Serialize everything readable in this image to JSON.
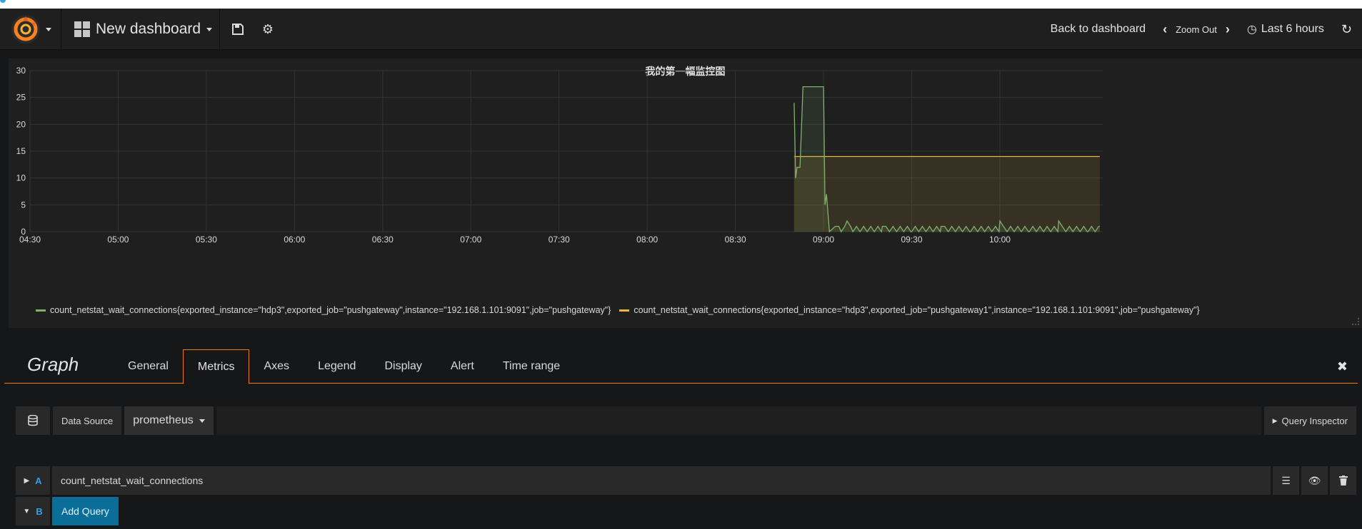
{
  "navbar": {
    "dashboard_title": "New dashboard",
    "back_label": "Back to dashboard",
    "zoom_out_label": "Zoom Out",
    "time_range_label": "Last 6 hours"
  },
  "panel": {
    "title": "我的第一幅监控图",
    "legend": [
      {
        "label": "count_netstat_wait_connections{exported_instance=\"hdp3\",exported_job=\"pushgateway\",instance=\"192.168.1.101:9091\",job=\"pushgateway\"}",
        "color": "#7eb26d"
      },
      {
        "label": "count_netstat_wait_connections{exported_instance=\"hdp3\",exported_job=\"pushgateway1\",instance=\"192.168.1.101:9091\",job=\"pushgateway\"}",
        "color": "#eab839"
      }
    ]
  },
  "chart_data": {
    "type": "area",
    "title": "我的第一幅监控图",
    "x_ticks": [
      "04:30",
      "05:00",
      "05:30",
      "06:00",
      "06:30",
      "07:00",
      "07:30",
      "08:00",
      "08:30",
      "09:00",
      "09:30",
      "10:00"
    ],
    "y_ticks": [
      "0",
      "5",
      "10",
      "15",
      "20",
      "25",
      "30"
    ],
    "ylim": [
      0,
      30
    ],
    "xlim": [
      "04:30",
      "10:35"
    ],
    "grid": true,
    "legend_position": "bottom",
    "series": [
      {
        "name": "count_netstat_wait_connections{exported_instance=\"hdp3\",exported_job=\"pushgateway\",instance=\"192.168.1.101:9091\",job=\"pushgateway\"}",
        "color": "#7eb26d",
        "points": [
          [
            "08:50",
            24
          ],
          [
            "08:50:30",
            10
          ],
          [
            "08:51",
            12
          ],
          [
            "08:52",
            12
          ],
          [
            "08:53",
            27
          ],
          [
            "09:00",
            27
          ],
          [
            "09:00:30",
            5
          ],
          [
            "09:01",
            7
          ],
          [
            "09:02",
            0
          ],
          [
            "09:04",
            1
          ],
          [
            "09:06",
            0
          ],
          [
            "09:08",
            2
          ],
          [
            "09:10",
            0
          ],
          [
            "09:20",
            1
          ],
          [
            "09:30",
            0
          ],
          [
            "09:40",
            1
          ],
          [
            "09:50",
            0
          ],
          [
            "10:00",
            2
          ],
          [
            "10:10",
            0
          ],
          [
            "10:20",
            2
          ],
          [
            "10:30",
            0
          ],
          [
            "10:34",
            1
          ]
        ]
      },
      {
        "name": "count_netstat_wait_connections{exported_instance=\"hdp3\",exported_job=\"pushgateway1\",instance=\"192.168.1.101:9091\",job=\"pushgateway\"}",
        "color": "#eab839",
        "points": [
          [
            "08:50",
            14
          ],
          [
            "10:34",
            14
          ]
        ]
      }
    ]
  },
  "editor": {
    "title": "Graph",
    "tabs": [
      "General",
      "Metrics",
      "Axes",
      "Legend",
      "Display",
      "Alert",
      "Time range"
    ],
    "active_tab": "Metrics",
    "datasource_label": "Data Source",
    "datasource_value": "prometheus",
    "query_inspector_label": "Query Inspector",
    "queries": [
      {
        "ref": "A",
        "expr": "count_netstat_wait_connections"
      }
    ],
    "next_ref": "B",
    "add_query_label": "Add Query"
  }
}
